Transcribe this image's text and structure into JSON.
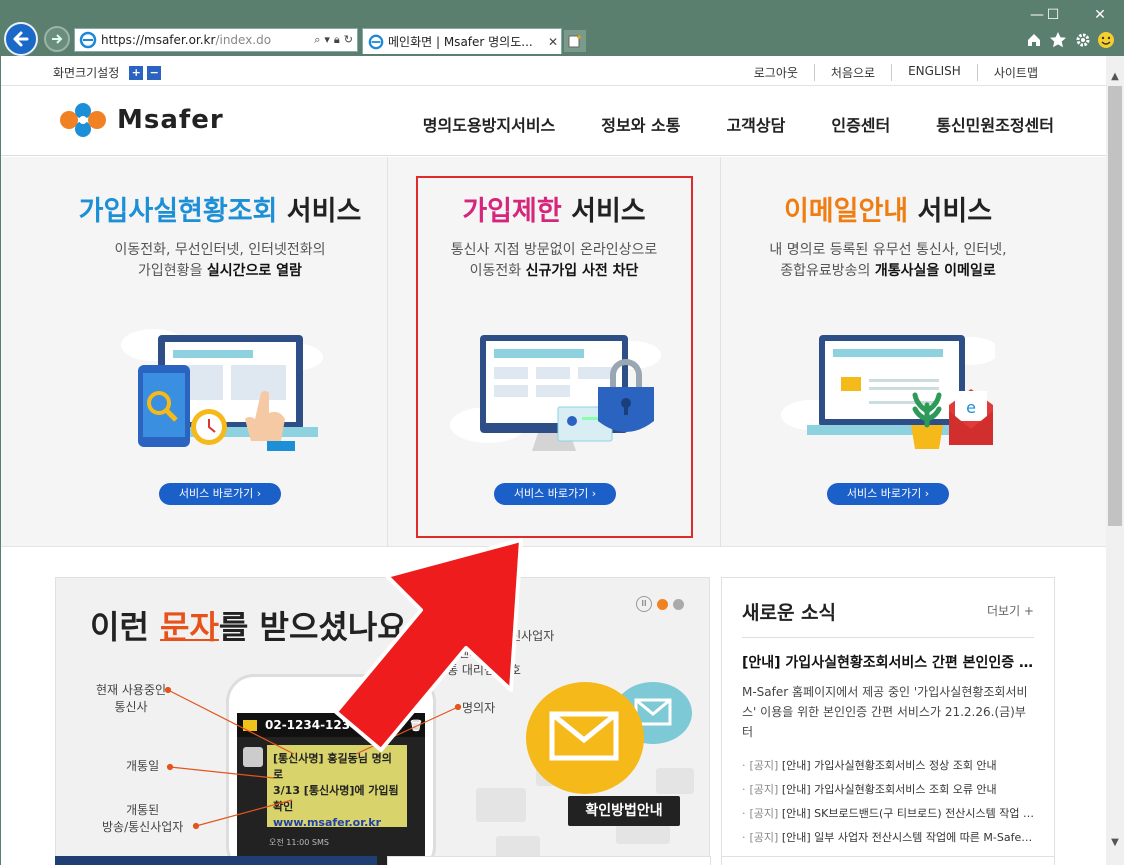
{
  "browser": {
    "url_main": "https://msafer.or.kr",
    "url_path": "/index.do",
    "tab_title": "메인화면 | Msafer 명의도...",
    "win_minimize": "—",
    "win_maximize": "☐",
    "win_close": "✕"
  },
  "utilbar": {
    "font_setting": "화면크기설정",
    "font_plus": "+",
    "font_minus": "−",
    "links": [
      "로그아웃",
      "처음으로",
      "ENGLISH",
      "사이트맵"
    ]
  },
  "header": {
    "logo_text": "Msafer",
    "nav": [
      "명의도용방지서비스",
      "정보와 소통",
      "고객상담",
      "인증센터",
      "통신민원조정센터"
    ]
  },
  "services": [
    {
      "title_accent": "가입사실현황조회",
      "title_rest": " 서비스",
      "accent_color": "#1c8fd6",
      "desc_line1": "이동전화, 무선인터넷, 인터넷전화의",
      "desc_line2_plain": "가입현황을 ",
      "desc_line2_bold": "실시간으로 열람",
      "button": "서비스 바로가기 ›"
    },
    {
      "title_accent": "가입제한",
      "title_rest": " 서비스",
      "accent_color": "#d6267c",
      "desc_line1": "통신사 지점 방문없이 온라인상으로",
      "desc_line2_plain": "이동전화 ",
      "desc_line2_bold": "신규가입 사전 차단",
      "button": "서비스 바로가기 ›"
    },
    {
      "title_accent": "이메일안내",
      "title_rest": " 서비스",
      "accent_color": "#f07d12",
      "desc_line1": "내 명의로 등록된 유무선 통신사, 인터넷,",
      "desc_line2_plain": "종합유료방송의 ",
      "desc_line2_bold": "개통사실을 이메일로",
      "button": "서비스 바로가기 ›"
    }
  ],
  "banner": {
    "title_pre": "이런 ",
    "title_accent": "문자",
    "title_post": "를 받으셨나요",
    "callouts": {
      "carrier": [
        "현재 사용중인",
        "통신사"
      ],
      "date": "개통일",
      "provider": [
        "개통된",
        "방송/통신사업자"
      ],
      "owner": "명의자",
      "center": [
        "개통된 방송/통신사업자",
        "고객센터 또는",
        "개통 대리점 번호"
      ]
    },
    "phone_number": "02-1234-1234",
    "sms_line1": "[통신사명] 홍길동님 명의로",
    "sms_line2": "3/13 [통신사명]에 가입됨",
    "sms_line3": "확인",
    "sms_link": "www.msafer.or.kr",
    "sms_time": "오전 11:00 SMS",
    "confirm_button": "확인방법안내",
    "pause": "II"
  },
  "news": {
    "title": "새로운 소식",
    "more": "더보기 +",
    "lead": "[안내] 가입사실현황조회서비스 간편 본인인증 서비스 도입",
    "body": "M-Safer 홈페이지에서 제공 중인 '가입사실현황조회서비스' 이용을 위한 본인인증 간편 서비스가 21.2.26.(금)부터",
    "items": [
      {
        "tag": "[공지]",
        "text": " [안내] 가입사실현황조회서비스 정상 조회 안내"
      },
      {
        "tag": "[공지]",
        "text": " [안내] 가입사실현황조회서비스 조회 오류 안내"
      },
      {
        "tag": "[공지]",
        "text": " [안내] SK브로드밴드(구 티브로드) 전산시스템 작업 안내"
      },
      {
        "tag": "[공지]",
        "text": " [안내] 일부 사업자 전산시스템 작업에 따른 M-Safer 이용 제한"
      }
    ]
  },
  "colors": {
    "primary_blue": "#1b5fc9",
    "highlight_red": "#e12a2a",
    "arrow_red": "#ee1c1c"
  }
}
